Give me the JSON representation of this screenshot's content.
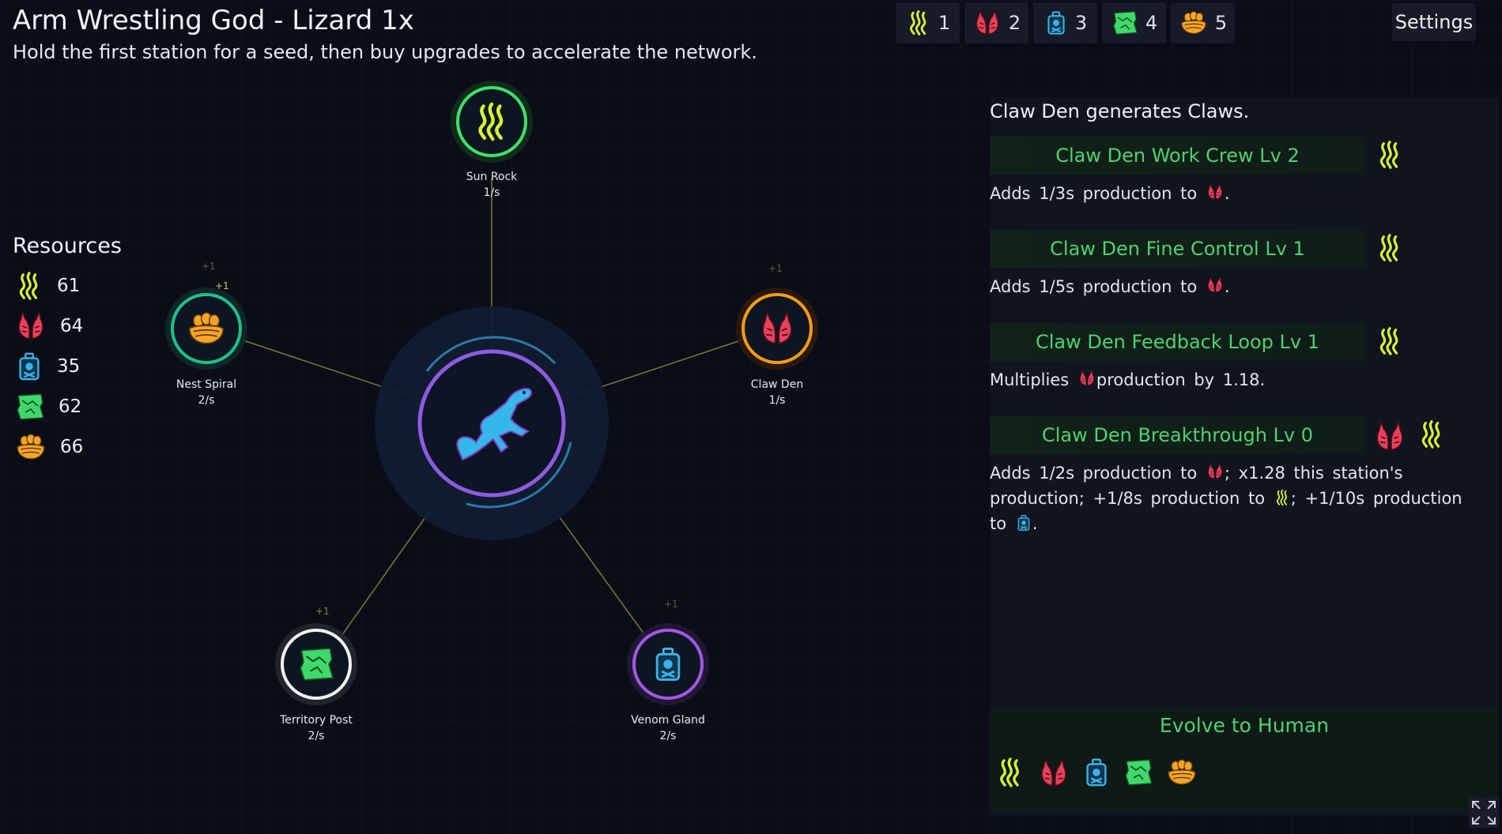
{
  "header": {
    "title": "Arm Wrestling God - Lizard  1x",
    "subtitle": "Hold the first station for a seed, then buy upgrades to accelerate the network."
  },
  "hotbar": [
    {
      "icon": "flame-icon",
      "key": "1"
    },
    {
      "icon": "claw-icon",
      "key": "2"
    },
    {
      "icon": "venom-icon",
      "key": "3"
    },
    {
      "icon": "territory-icon",
      "key": "4"
    },
    {
      "icon": "nest-icon",
      "key": "5"
    }
  ],
  "settings_label": "Settings",
  "resources": {
    "title": "Resources",
    "items": [
      {
        "icon": "flame-icon",
        "value": "61"
      },
      {
        "icon": "claw-icon",
        "value": "64"
      },
      {
        "icon": "venom-icon",
        "value": "35"
      },
      {
        "icon": "territory-icon",
        "value": "62"
      },
      {
        "icon": "nest-icon",
        "value": "66"
      }
    ]
  },
  "stations": {
    "sun_rock": {
      "name": "Sun Rock",
      "rate": "1/s"
    },
    "nest_spiral": {
      "name": "Nest Spiral",
      "rate": "2/s",
      "gain": "+1",
      "gain2": "+1"
    },
    "claw_den": {
      "name": "Claw Den",
      "rate": "1/s",
      "gain": "+1"
    },
    "territory_post": {
      "name": "Territory Post",
      "rate": "2/s",
      "gain": "+1"
    },
    "venom_gland": {
      "name": "Venom Gland",
      "rate": "2/s",
      "gain": "+1"
    }
  },
  "panel": {
    "heading": "Claw Den generates Claws.",
    "upgrades": [
      {
        "title": "Claw Den Work Crew  Lv 2",
        "desc_pre": "Adds 1/3s production to",
        "desc_post": "."
      },
      {
        "title": "Claw Den Fine Control  Lv 1",
        "desc_pre": "Adds 1/5s production to",
        "desc_post": "."
      },
      {
        "title": "Claw Den Feedback Loop  Lv 1",
        "desc_pre": "Multiplies",
        "desc_post": "production by 1.18."
      },
      {
        "title": "Claw Den Breakthrough  Lv 0",
        "d1": "Adds 1/2s production to",
        "d2": "; x1.28 this station's production; +1/8s production to",
        "d3": "; +1/10s production to",
        "d4": "."
      }
    ],
    "evolve_label": "Evolve to Human"
  },
  "colors": {
    "accent_green": "#4fd26e",
    "flame": "#d8f03a",
    "claw": "#e9405c",
    "venom": "#3ab4e8",
    "territory": "#3fd86a",
    "nest": "#f7a52a",
    "core_ring": "#8e5be0"
  }
}
